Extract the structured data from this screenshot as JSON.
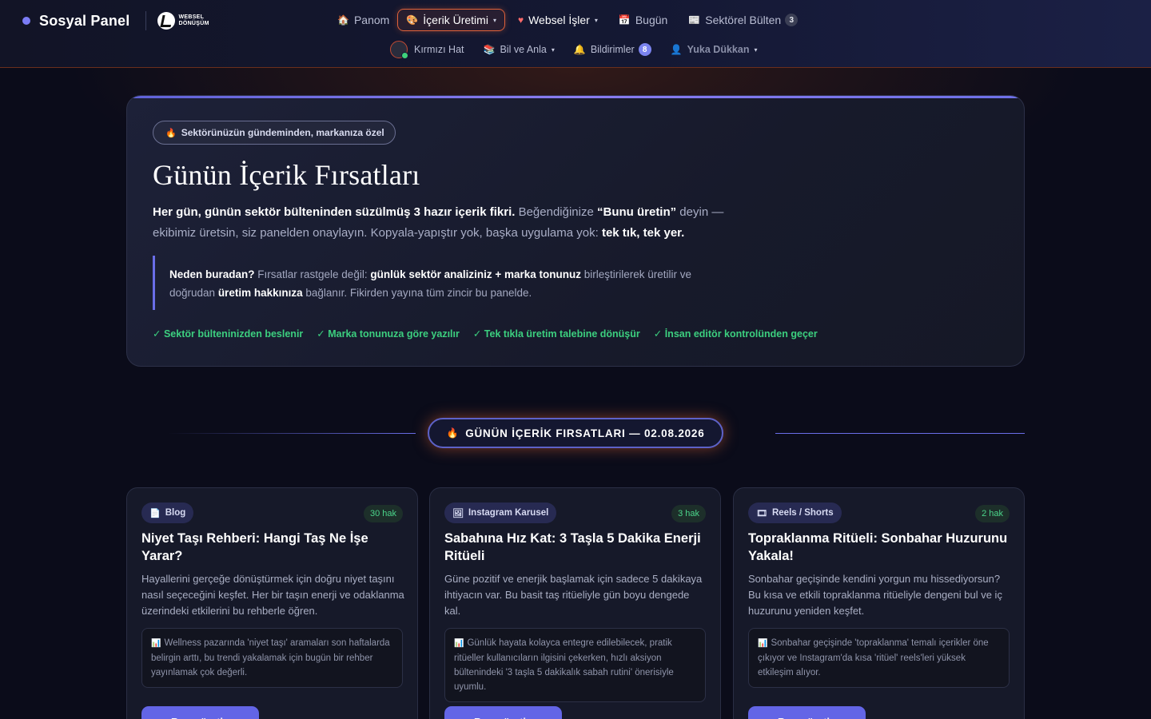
{
  "brand": {
    "title": "Sosyal Panel",
    "logo_line1": "WEBSEL",
    "logo_line2": "DÖNÜŞÜM"
  },
  "nav_primary": [
    {
      "icon": "home-icon",
      "label": "Panom",
      "active": false
    },
    {
      "icon": "palette-icon",
      "label": "İçerik Üretimi",
      "active": true,
      "caret": true
    },
    {
      "icon": "heart-icon",
      "label": "Websel İşler",
      "caret": true
    },
    {
      "icon": "calendar-icon",
      "label": "Bugün"
    },
    {
      "icon": "newspaper-icon",
      "label": "Sektörel Bülten",
      "count": "3"
    }
  ],
  "nav_secondary": [
    {
      "icon": "avatar-icon",
      "label": "Kırmızı Hat"
    },
    {
      "icon": "books-icon",
      "label": "Bil ve Anla",
      "caret": true
    },
    {
      "icon": "bell-icon",
      "label": "Bildirimler",
      "count": "8"
    },
    {
      "icon": "user-icon",
      "label": "Yuka Dükkan",
      "caret": true
    }
  ],
  "hero": {
    "badge": "Sektörünüzün gündeminden, markanıza özel",
    "title": "Günün İçerik Fırsatları",
    "lead_bold_1": "Her gün, günün sektör bülteninden süzülmüş 3 hazır içerik fikri.",
    "lead_text_1": " Beğendiğinize ",
    "lead_bold_2": "“Bunu üretin”",
    "lead_text_2": " deyin — ekibimiz üretsin, siz panelden onaylayın. Kopyala-yapıştır yok, başka uygulama yok: ",
    "lead_bold_3": "tek tık, tek yer.",
    "why_label": "Neden buradan?",
    "why_text_1": " Fırsatlar rastgele değil: ",
    "why_bold_1": "günlük sektör analiziniz + marka tonunuz",
    "why_text_2": " birleştirilerek üretilir ve doğrudan ",
    "why_bold_2": "üretim hakkınıza",
    "why_text_3": " bağlanır. Fikirden yayına tüm zincir bu panelde.",
    "checks": [
      "✓ Sektör bülteninizden beslenir",
      "✓ Marka tonunuza göre yazılır",
      "✓ Tek tıkla üretim talebine dönüşür",
      "✓ İnsan editör kontrolünden geçer"
    ]
  },
  "section": {
    "label": "GÜNÜN İÇERİK FIRSATLARI — 02.08.2026"
  },
  "cards": [
    {
      "type_icon": "document-icon",
      "type": "Blog",
      "rights": "30 hak",
      "title": "Niyet Taşı Rehberi: Hangi Taş Ne İşe Yarar?",
      "desc": "Hayallerini gerçeğe dönüştürmek için doğru niyet taşını nasıl seçeceğini keşfet. Her bir taşın enerji ve odaklanma üzerindeki etkilerini bu rehberle öğren.",
      "note": "Wellness pazarında 'niyet taşı' aramaları son haftalarda belirgin arttı, bu trendi yakalamak için bugün bir rehber yayınlamak çok değerli.",
      "button": "Bunu üretin"
    },
    {
      "type_icon": "image-icon",
      "type": "Instagram Karusel",
      "rights": "3 hak",
      "title": "Sabahına Hız Kat: 3 Taşla 5 Dakika Enerji Ritüeli",
      "desc": "Güne pozitif ve enerjik başlamak için sadece 5 dakikaya ihtiyacın var. Bu basit taş ritüeliyle gün boyu dengede kal.",
      "note": "Günlük hayata kolayca entegre edilebilecek, pratik ritüeller kullanıcıların ilgisini çekerken, hızlı aksiyon bültenindeki '3 taşla 5 dakikalık sabah rutini' önerisiyle uyumlu.",
      "button": "Bunu üretin"
    },
    {
      "type_icon": "film-icon",
      "type": "Reels / Shorts",
      "rights": "2 hak",
      "title": "Topraklanma Ritüeli: Sonbahar Huzurunu Yakala!",
      "desc": "Sonbahar geçişinde kendini yorgun mu hissediyorsun? Bu kısa ve etkili topraklanma ritüeliyle dengeni bul ve iç huzurunu yeniden keşfet.",
      "note": "Sonbahar geçişinde 'topraklanma' temalı içerikler öne çıkıyor ve Instagram'da kısa 'ritüel' reels'leri yüksek etkileşim alıyor.",
      "button": "Bunu üretin"
    }
  ],
  "colors": {
    "accent": "#6365e6",
    "active_border": "#e0623a",
    "success": "#3ccf7f"
  }
}
